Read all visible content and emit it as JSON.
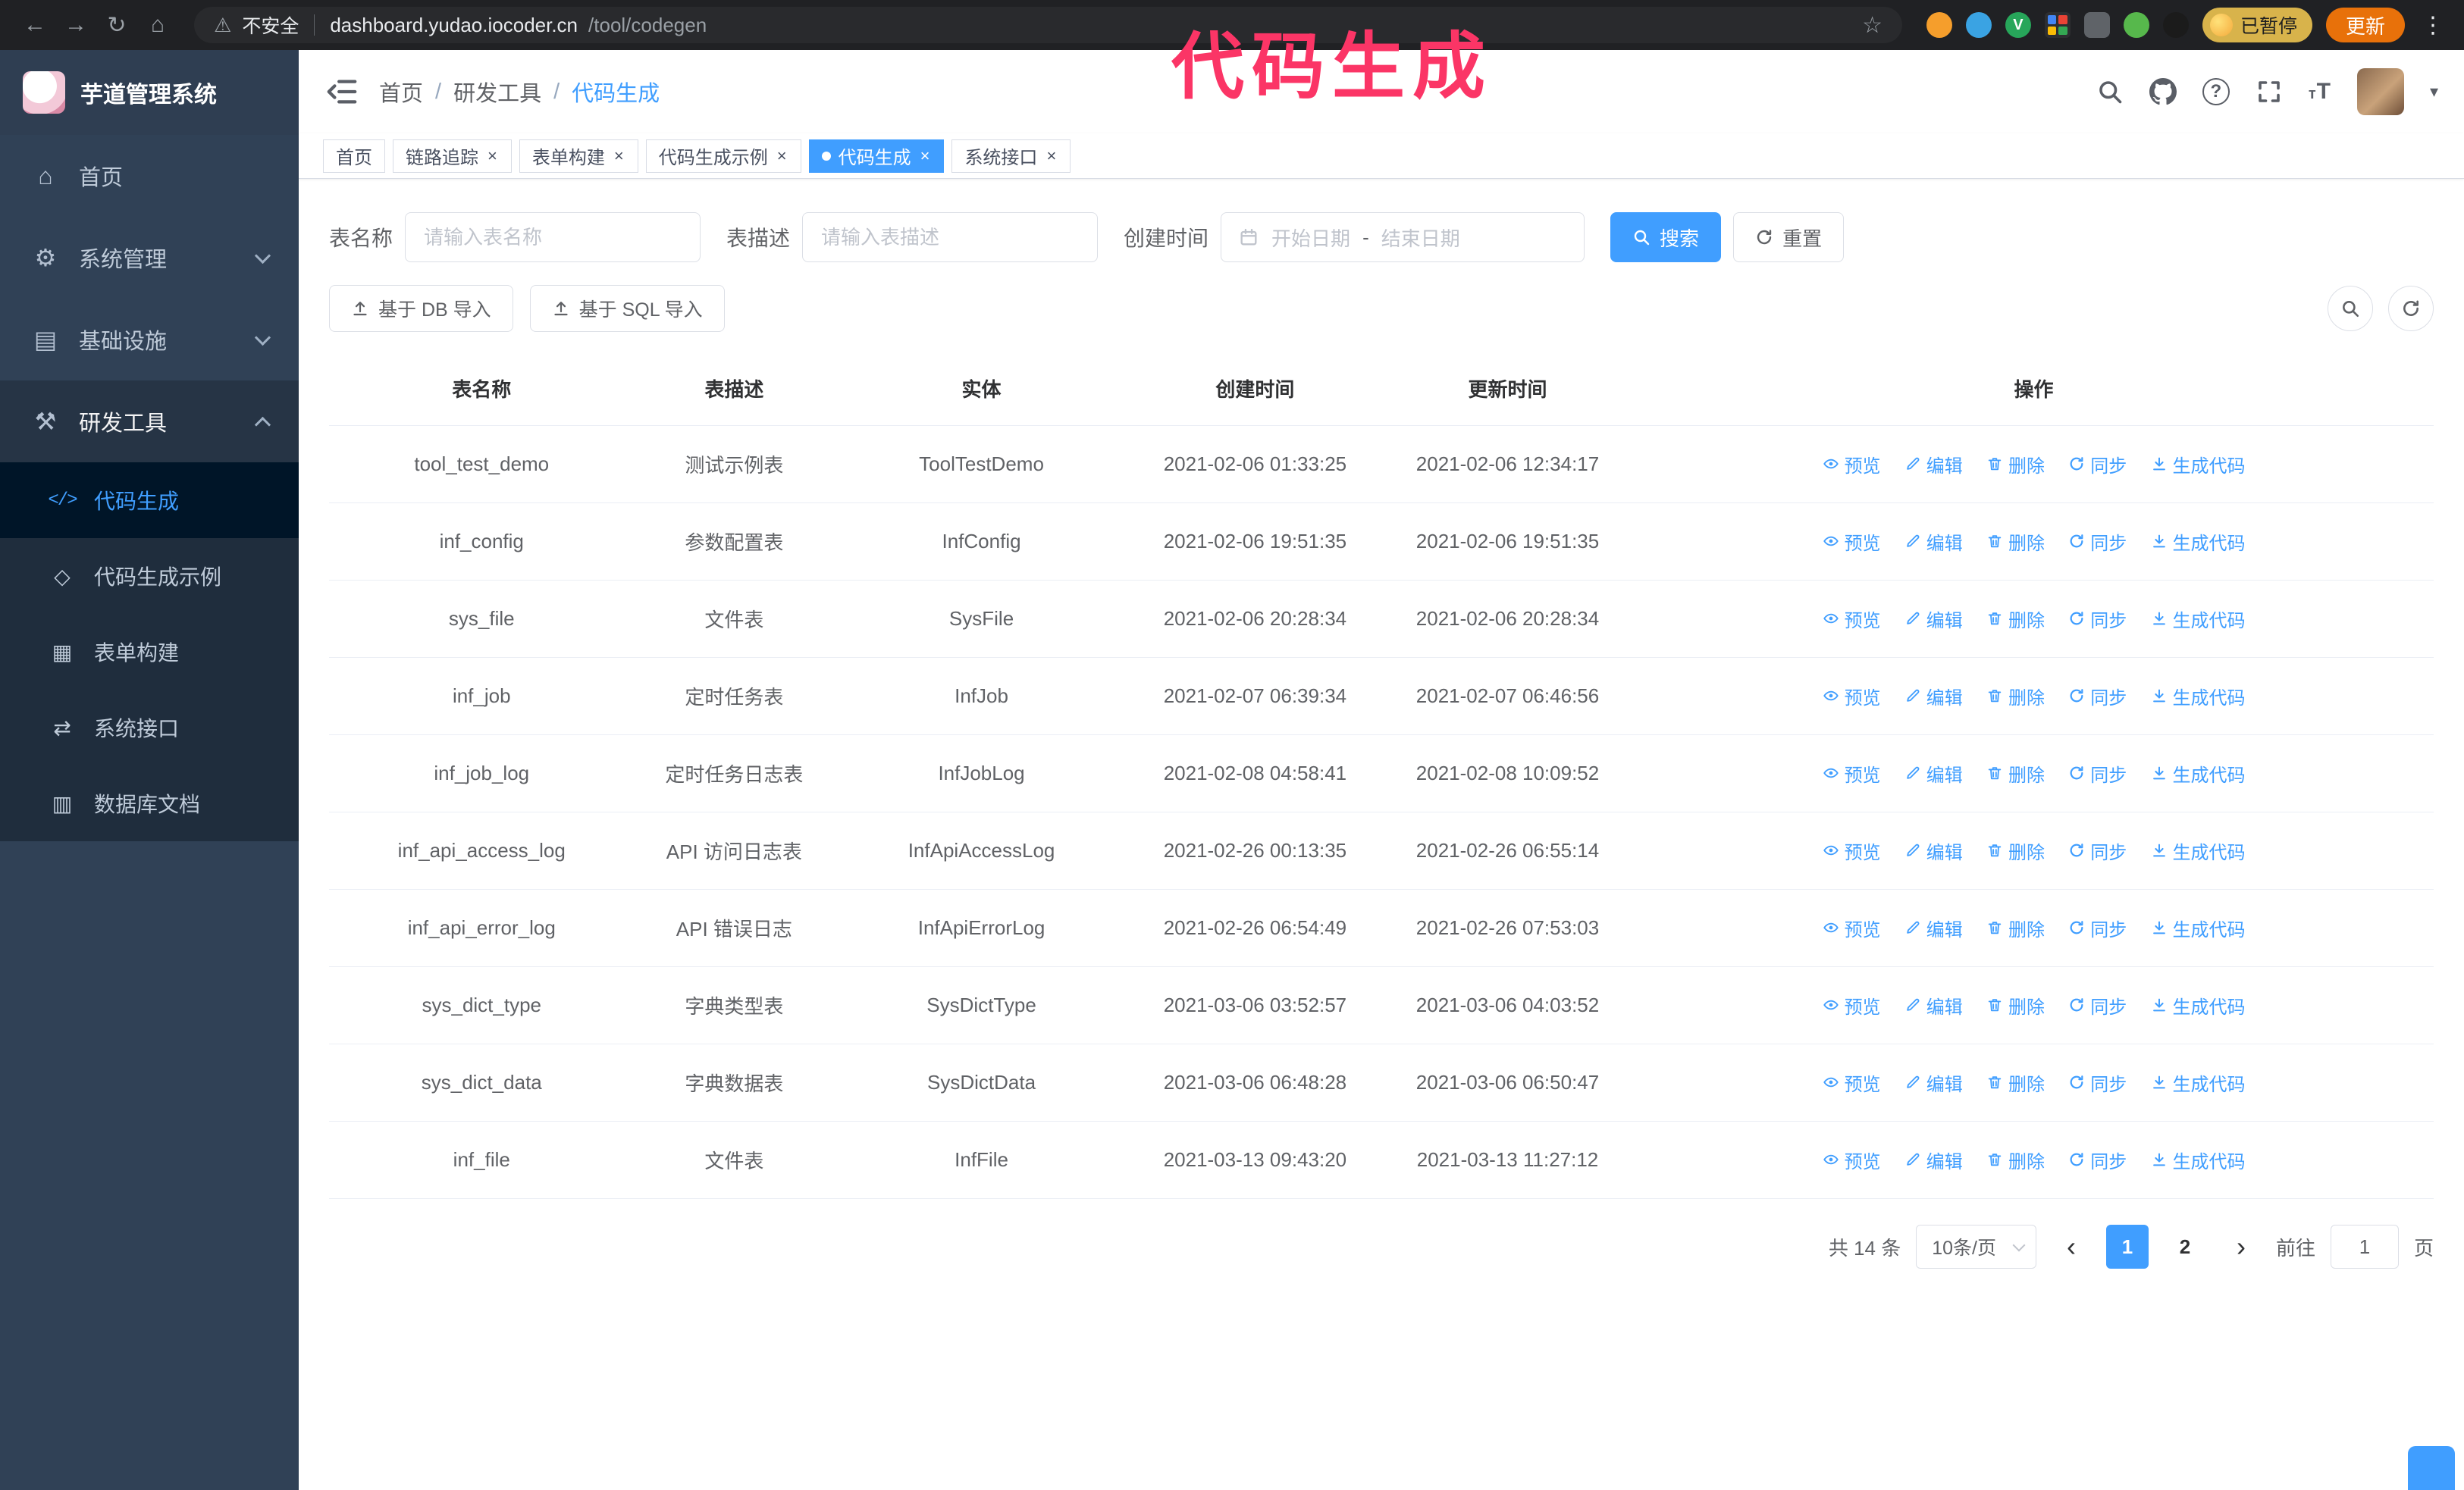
{
  "annotation": "代码生成",
  "colors": {
    "accent": "#409EFF",
    "annotation_pink": "#FB3566",
    "sidebar_bg": "#304156",
    "submenu_bg": "#1F2D3D",
    "active_item_bg": "#001528",
    "update_pill": "#E8710A",
    "paused_badge": "#D8B34B"
  },
  "icons": {
    "back": "←",
    "forward": "→",
    "reload": "↻",
    "home": "⌂",
    "warning": "⚠",
    "star": "☆",
    "kebab": "⋮",
    "caret_down": "▾",
    "nav_home": "⌂",
    "nav_system": "⚙",
    "nav_infra": "▤",
    "nav_devtools": "⚒",
    "sub_codegen": "</>",
    "sub_example": "◇",
    "sub_form": "▦",
    "sub_api": "⇄",
    "sub_dbdoc": "▥",
    "ext_v": "V"
  },
  "browser": {
    "security_warning": "不安全",
    "url_host": "dashboard.yudao.iocoder.cn",
    "url_path": "/tool/codegen",
    "paused_badge": "已暂停",
    "update_button": "更新"
  },
  "sidebar": {
    "app_title": "芋道管理系统",
    "items": [
      {
        "label": "首页"
      },
      {
        "label": "系统管理"
      },
      {
        "label": "基础设施"
      },
      {
        "label": "研发工具"
      }
    ],
    "subitems": [
      {
        "label": "代码生成"
      },
      {
        "label": "代码生成示例"
      },
      {
        "label": "表单构建"
      },
      {
        "label": "系统接口"
      },
      {
        "label": "数据库文档"
      }
    ]
  },
  "header": {
    "breadcrumb": [
      "首页",
      "研发工具",
      "代码生成"
    ]
  },
  "tabs": [
    {
      "label": "首页"
    },
    {
      "label": "链路追踪"
    },
    {
      "label": "表单构建"
    },
    {
      "label": "代码生成示例"
    },
    {
      "label": "代码生成"
    },
    {
      "label": "系统接口"
    }
  ],
  "filters": {
    "table_name_label": "表名称",
    "table_name_placeholder": "请输入表名称",
    "table_desc_label": "表描述",
    "table_desc_placeholder": "请输入表描述",
    "create_time_label": "创建时间",
    "date_start_placeholder": "开始日期",
    "date_separator": "-",
    "date_end_placeholder": "结束日期",
    "search_button": "搜索",
    "reset_button": "重置"
  },
  "toolbar": {
    "import_db": "基于 DB 导入",
    "import_sql": "基于 SQL 导入"
  },
  "table": {
    "columns": [
      "表名称",
      "表描述",
      "实体",
      "创建时间",
      "更新时间",
      "操作"
    ],
    "actions": [
      "预览",
      "编辑",
      "删除",
      "同步",
      "生成代码"
    ],
    "rows": [
      {
        "name": "tool_test_demo",
        "desc": "测试示例表",
        "entity": "ToolTestDemo",
        "created": "2021-02-06 01:33:25",
        "updated": "2021-02-06 12:34:17"
      },
      {
        "name": "inf_config",
        "desc": "参数配置表",
        "entity": "InfConfig",
        "created": "2021-02-06 19:51:35",
        "updated": "2021-02-06 19:51:35"
      },
      {
        "name": "sys_file",
        "desc": "文件表",
        "entity": "SysFile",
        "created": "2021-02-06 20:28:34",
        "updated": "2021-02-06 20:28:34"
      },
      {
        "name": "inf_job",
        "desc": "定时任务表",
        "entity": "InfJob",
        "created": "2021-02-07 06:39:34",
        "updated": "2021-02-07 06:46:56"
      },
      {
        "name": "inf_job_log",
        "desc": "定时任务日志表",
        "entity": "InfJobLog",
        "created": "2021-02-08 04:58:41",
        "updated": "2021-02-08 10:09:52"
      },
      {
        "name": "inf_api_access_log",
        "desc": "API 访问日志表",
        "entity": "InfApiAccessLog",
        "created": "2021-02-26 00:13:35",
        "updated": "2021-02-26 06:55:14"
      },
      {
        "name": "inf_api_error_log",
        "desc": "API 错误日志",
        "entity": "InfApiErrorLog",
        "created": "2021-02-26 06:54:49",
        "updated": "2021-02-26 07:53:03"
      },
      {
        "name": "sys_dict_type",
        "desc": "字典类型表",
        "entity": "SysDictType",
        "created": "2021-03-06 03:52:57",
        "updated": "2021-03-06 04:03:52"
      },
      {
        "name": "sys_dict_data",
        "desc": "字典数据表",
        "entity": "SysDictData",
        "created": "2021-03-06 06:48:28",
        "updated": "2021-03-06 06:50:47"
      },
      {
        "name": "inf_file",
        "desc": "文件表",
        "entity": "InfFile",
        "created": "2021-03-13 09:43:20",
        "updated": "2021-03-13 11:27:12"
      }
    ]
  },
  "pagination": {
    "total": "共 14 条",
    "page_size": "10条/页",
    "pages": [
      "1",
      "2"
    ],
    "goto_label": "前往",
    "goto_value": "1",
    "page_suffix": "页"
  }
}
